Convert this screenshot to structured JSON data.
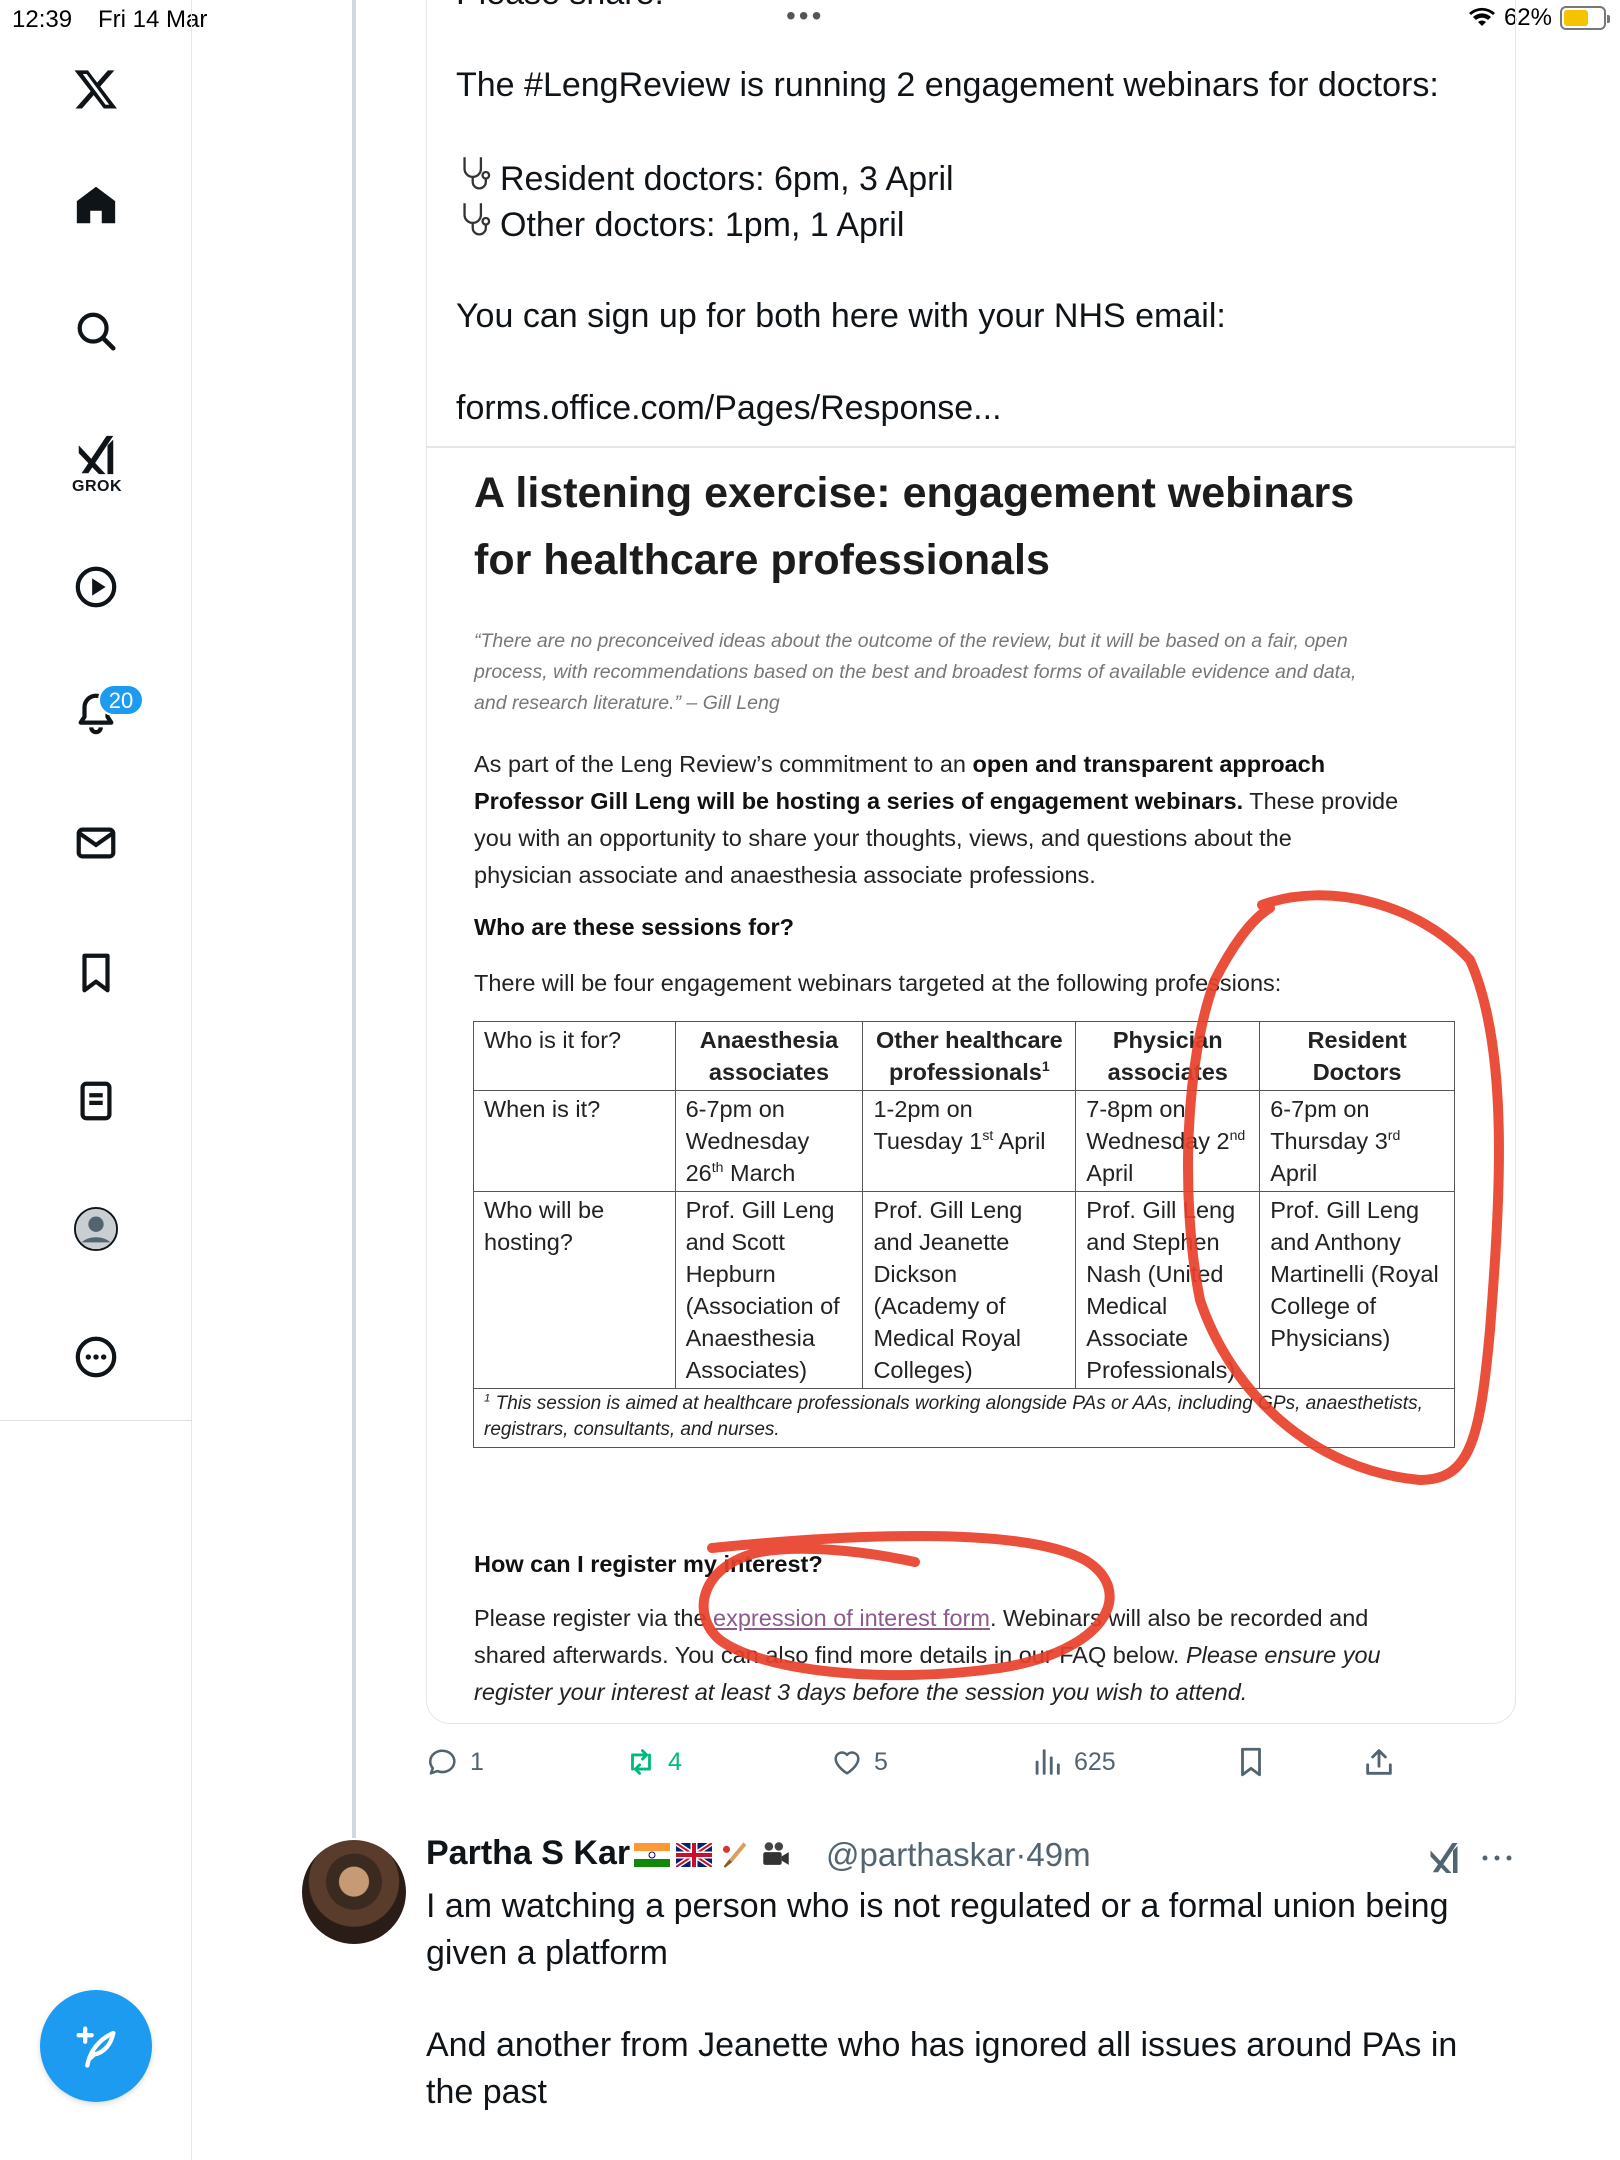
{
  "status_bar": {
    "time": "12:39",
    "date": "Fri 14 Mar",
    "battery": "62%",
    "battery_level": 0.62
  },
  "sidebar": {
    "grok_label": "GROK",
    "notifications_count": "20",
    "icons": [
      "x-logo-icon",
      "home-icon",
      "search-icon",
      "grok-icon",
      "play-icon",
      "bell-icon",
      "mail-icon",
      "bookmark-icon",
      "list-icon",
      "avatar-icon",
      "more-icon",
      "compose-icon"
    ]
  },
  "tweet": {
    "partial_line": "Please share:",
    "line1": "The #LengReview is running 2 engagement webinars for doctors:",
    "line2": "Resident doctors: 6pm, 3 April",
    "line3": "Other doctors: 1pm, 1 April",
    "line4": "You can sign up for both here with your NHS email:",
    "link": "forms.office.com/Pages/Response..."
  },
  "document": {
    "title_line1": "A listening exercise: engagement webinars",
    "title_line2": "for healthcare professionals",
    "quote_line1": "“There are no preconceived ideas about the outcome of the review, but it will be based on a fair, open",
    "quote_line2": "process, with recommendations based on the best and broadest forms of available evidence and data,",
    "quote_line3": "and research literature.” – Gill Leng",
    "p1_a": "As part of the Leng Review’s commitment to an ",
    "p1_b": "open and transparent approach",
    "p1_c": "Professor Gill Leng will be hosting a series of engagement webinars.",
    "p1_d": " These provide",
    "p1_e": "you with an opportunity to share your thoughts, views, and questions about the",
    "p1_f": "physician associate and anaesthesia associate professions.",
    "h_who": "Who are these sessions for?",
    "p2": "There will be four engagement webinars targeted at the following professions:",
    "table": {
      "row_labels": [
        "Who is it for?",
        "When is it?",
        "Who will be hosting?"
      ],
      "columns": [
        {
          "who": "Anaesthesia associates",
          "when_a": "6-7pm on Wednesday 26",
          "when_sup": "th",
          "when_b": " March",
          "host": "Prof. Gill Leng and Scott Hepburn (Association of Anaesthesia Associates)"
        },
        {
          "who": "Other healthcare professionals",
          "who_sup": "1",
          "when_a": "1-2pm on Tuesday 1",
          "when_sup": "st",
          "when_b": " April",
          "host": "Prof. Gill Leng and Jeanette Dickson (Academy of Medical Royal Colleges)"
        },
        {
          "who": "Physician associates",
          "when_a": "7-8pm on Wednesday 2",
          "when_sup": "nd",
          "when_b": " April",
          "host": "Prof. Gill Leng and Stephen Nash (United Medical Associate Professionals)"
        },
        {
          "who": "Resident Doctors",
          "when_a": "6-7pm on Thursday 3",
          "when_sup": "rd",
          "when_b": " April",
          "host": "Prof. Gill Leng and Anthony Martinelli (Royal College of Physicians)"
        }
      ],
      "footnote_mark": "1",
      "footnote": " This session is aimed at healthcare professionals working alongside PAs or AAs, including GPs, anaesthetists, registrars, consultants, and nurses."
    },
    "h_register": "How can I register my interest?",
    "p3_a": "Please register via the ",
    "p3_link": "expression of interest form",
    "p3_b": ". Webinars will also be recorded and",
    "p3_c": "shared afterwards. You can also find more details in our FAQ below. ",
    "p3_d": "Please ensure you",
    "p3_e": "register your interest at least 3 days before the session you wish to attend."
  },
  "actions": {
    "replies": "1",
    "reposts": "4",
    "likes": "5",
    "views": "625"
  },
  "reply": {
    "name": "Partha S Kar",
    "handle": "@parthaskar",
    "separator": "·",
    "time": "49m",
    "text1": "I am watching a person who is not regulated or a formal union being",
    "text2": "given a platform",
    "text3": "And another from Jeanette who has ignored all issues around PAs in",
    "text4": "the past"
  },
  "colors": {
    "accent": "#1d9bf0",
    "repost": "#00ba7c",
    "annotation": "#e8402a"
  }
}
